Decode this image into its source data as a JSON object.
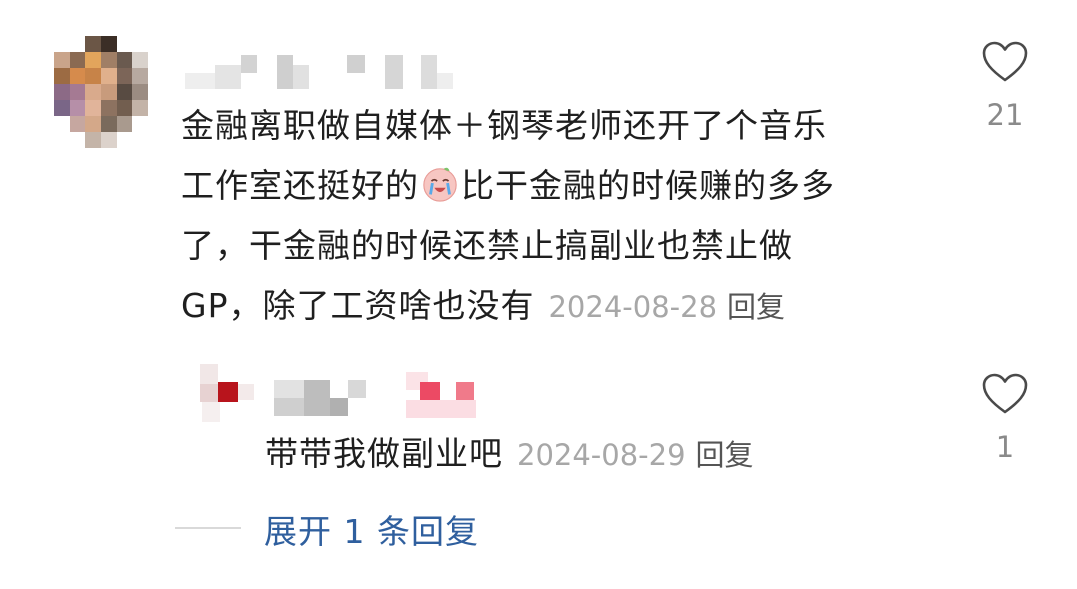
{
  "comment": {
    "text_line1": "金融离职做自媒体＋钢琴老师还开了个音乐",
    "text_line2a": "工作室还挺好的",
    "text_line2b": "比干金融的时候赚的多多",
    "text_line3": "了，干金融的时候还禁止搞副业也禁止做",
    "text_line4": "GP，除了工资啥也没有",
    "emoji": "crying-face-emoji",
    "date": "2024-08-28",
    "reply_label": "回复",
    "like_count": "21",
    "author_avatar": "pixelated-avatar",
    "author_name": "pixelated-username"
  },
  "reply": {
    "text": "带带我做副业吧",
    "date": "2024-08-29",
    "reply_label": "回复",
    "like_count": "1",
    "author_name": "pixelated-username"
  },
  "expand": {
    "label": "展开 1 条回复"
  },
  "colors": {
    "text": "#1f1f1f",
    "meta": "#a7a7a7",
    "link": "#2f5f9e",
    "heart_stroke": "#4a4a4a"
  }
}
